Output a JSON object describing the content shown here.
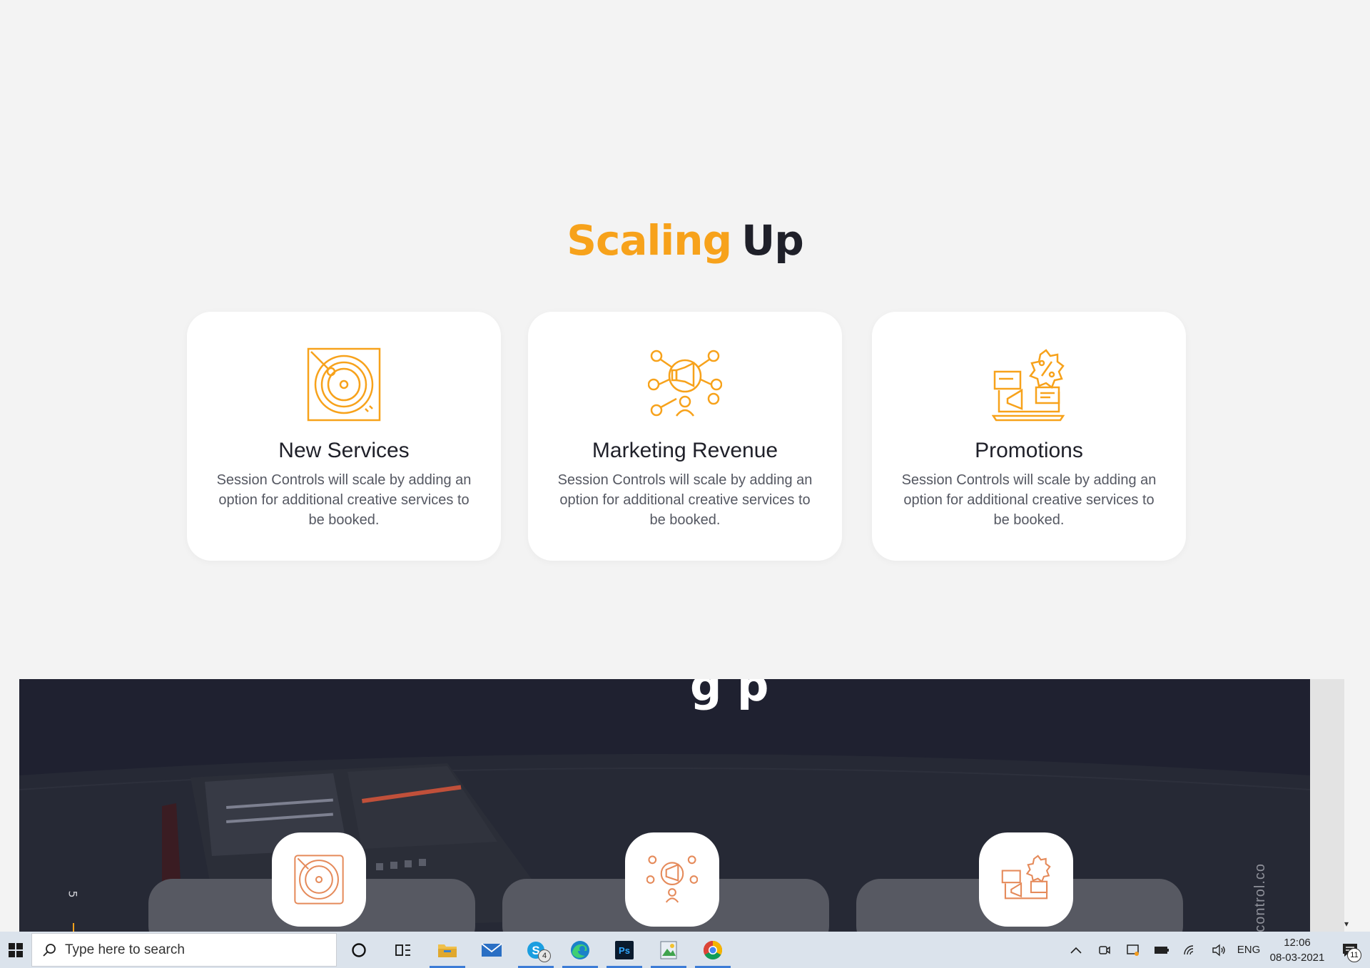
{
  "section": {
    "title_accent": "Scaling",
    "title_rest": "Up"
  },
  "cards": [
    {
      "icon": "turntable-icon",
      "title": "New Services",
      "text": "Session Controls will scale by adding an option for additional creative services to be booked."
    },
    {
      "icon": "megaphone-network-icon",
      "title": "Marketing Revenue",
      "text": "Session Controls will scale by adding an option for additional creative services to be booked."
    },
    {
      "icon": "promotion-icon",
      "title": "Promotions",
      "text": "Session Controls will scale by adding an option for additional creative services to be booked."
    }
  ],
  "dark_section": {
    "title_fragment": "g p",
    "website": "w.sessioncontrol.co",
    "slide_number": "5"
  },
  "taskbar": {
    "search_placeholder": "Type here to search",
    "skype_badge": "4",
    "language": "ENG",
    "time": "12:06",
    "date": "08-03-2021",
    "notification_count": "11",
    "photoshop_label": "Ps"
  },
  "colors": {
    "accent": "#f7a21b",
    "dark": "#1f2029",
    "panel": "#1f2130",
    "card_bg": "#ffffff",
    "page_bg": "#f3f3f3"
  }
}
